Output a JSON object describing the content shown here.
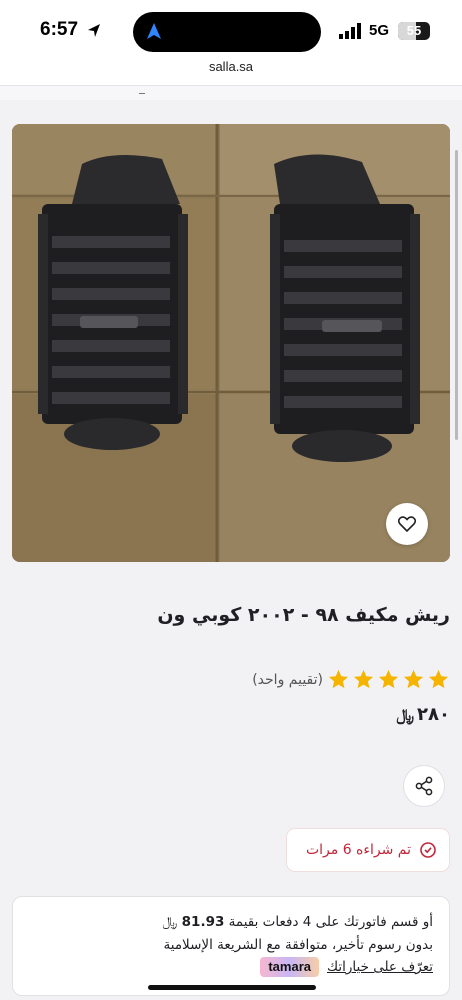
{
  "status_bar": {
    "time": "6:57",
    "network": "5G",
    "battery": "55",
    "battery_level": 0.55
  },
  "browser": {
    "url": "salla.sa"
  },
  "product": {
    "title": "ريش مكيف ٩٨ - ٢٠٠٢ كوبي ون",
    "rating_stars": 5,
    "rating_count_text": "(تقييم واحد)",
    "price": "٢٨٠",
    "currency_symbol": "﷼",
    "sold_text": "تم شراءه 6 مرات"
  },
  "installments": {
    "line1_prefix": "أو قسم فاتورتك على 4 دفعات بقيمة",
    "amount": "81.93",
    "currency_symbol": "﷼",
    "line2": "بدون رسوم تأخير، متوافقة مع الشريعة الإسلامية",
    "learn_more": "تعرّف على خياراتك",
    "provider": "tamara"
  },
  "icons": [
    "location-arrow-icon",
    "navigation-arrow-icon",
    "signal-icon",
    "heart-icon",
    "star-icon",
    "share-icon",
    "badge-icon"
  ],
  "colors": {
    "star": "#f5b400",
    "sold_text": "#c0283a",
    "background": "#f2f2f4"
  }
}
